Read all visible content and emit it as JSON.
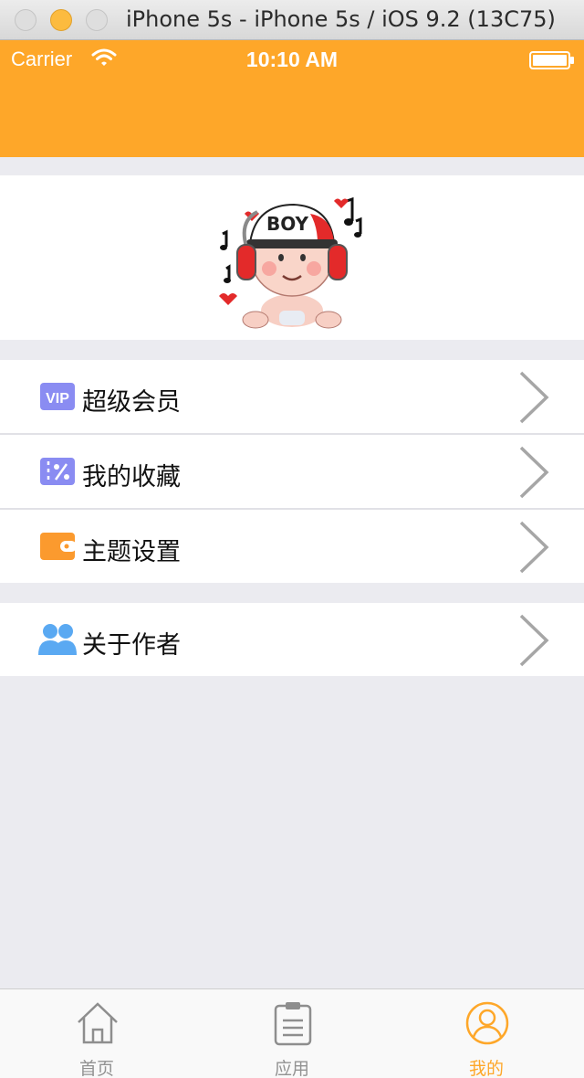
{
  "window": {
    "title": "iPhone 5s - iPhone 5s / iOS 9.2 (13C75)"
  },
  "status_bar": {
    "carrier": "Carrier",
    "time": "10:10 AM"
  },
  "colors": {
    "accent": "#fea729",
    "vip_icon": "#8a8cf2",
    "collection_icon": "#8a8cf2",
    "theme_icon": "#fb9a2e",
    "author_icon": "#5aa9f2"
  },
  "menu": {
    "group1": [
      {
        "icon": "vip-icon",
        "label": "超级会员"
      },
      {
        "icon": "coupon-icon",
        "label": "我的收藏"
      },
      {
        "icon": "wallet-icon",
        "label": "主题设置"
      }
    ],
    "group2": [
      {
        "icon": "people-icon",
        "label": "关于作者"
      }
    ]
  },
  "vip_badge_text": "VIP",
  "tabs": [
    {
      "icon": "home-icon",
      "label": "首页",
      "active": false
    },
    {
      "icon": "clipboard-icon",
      "label": "应用",
      "active": false
    },
    {
      "icon": "profile-icon",
      "label": "我的",
      "active": true
    }
  ]
}
